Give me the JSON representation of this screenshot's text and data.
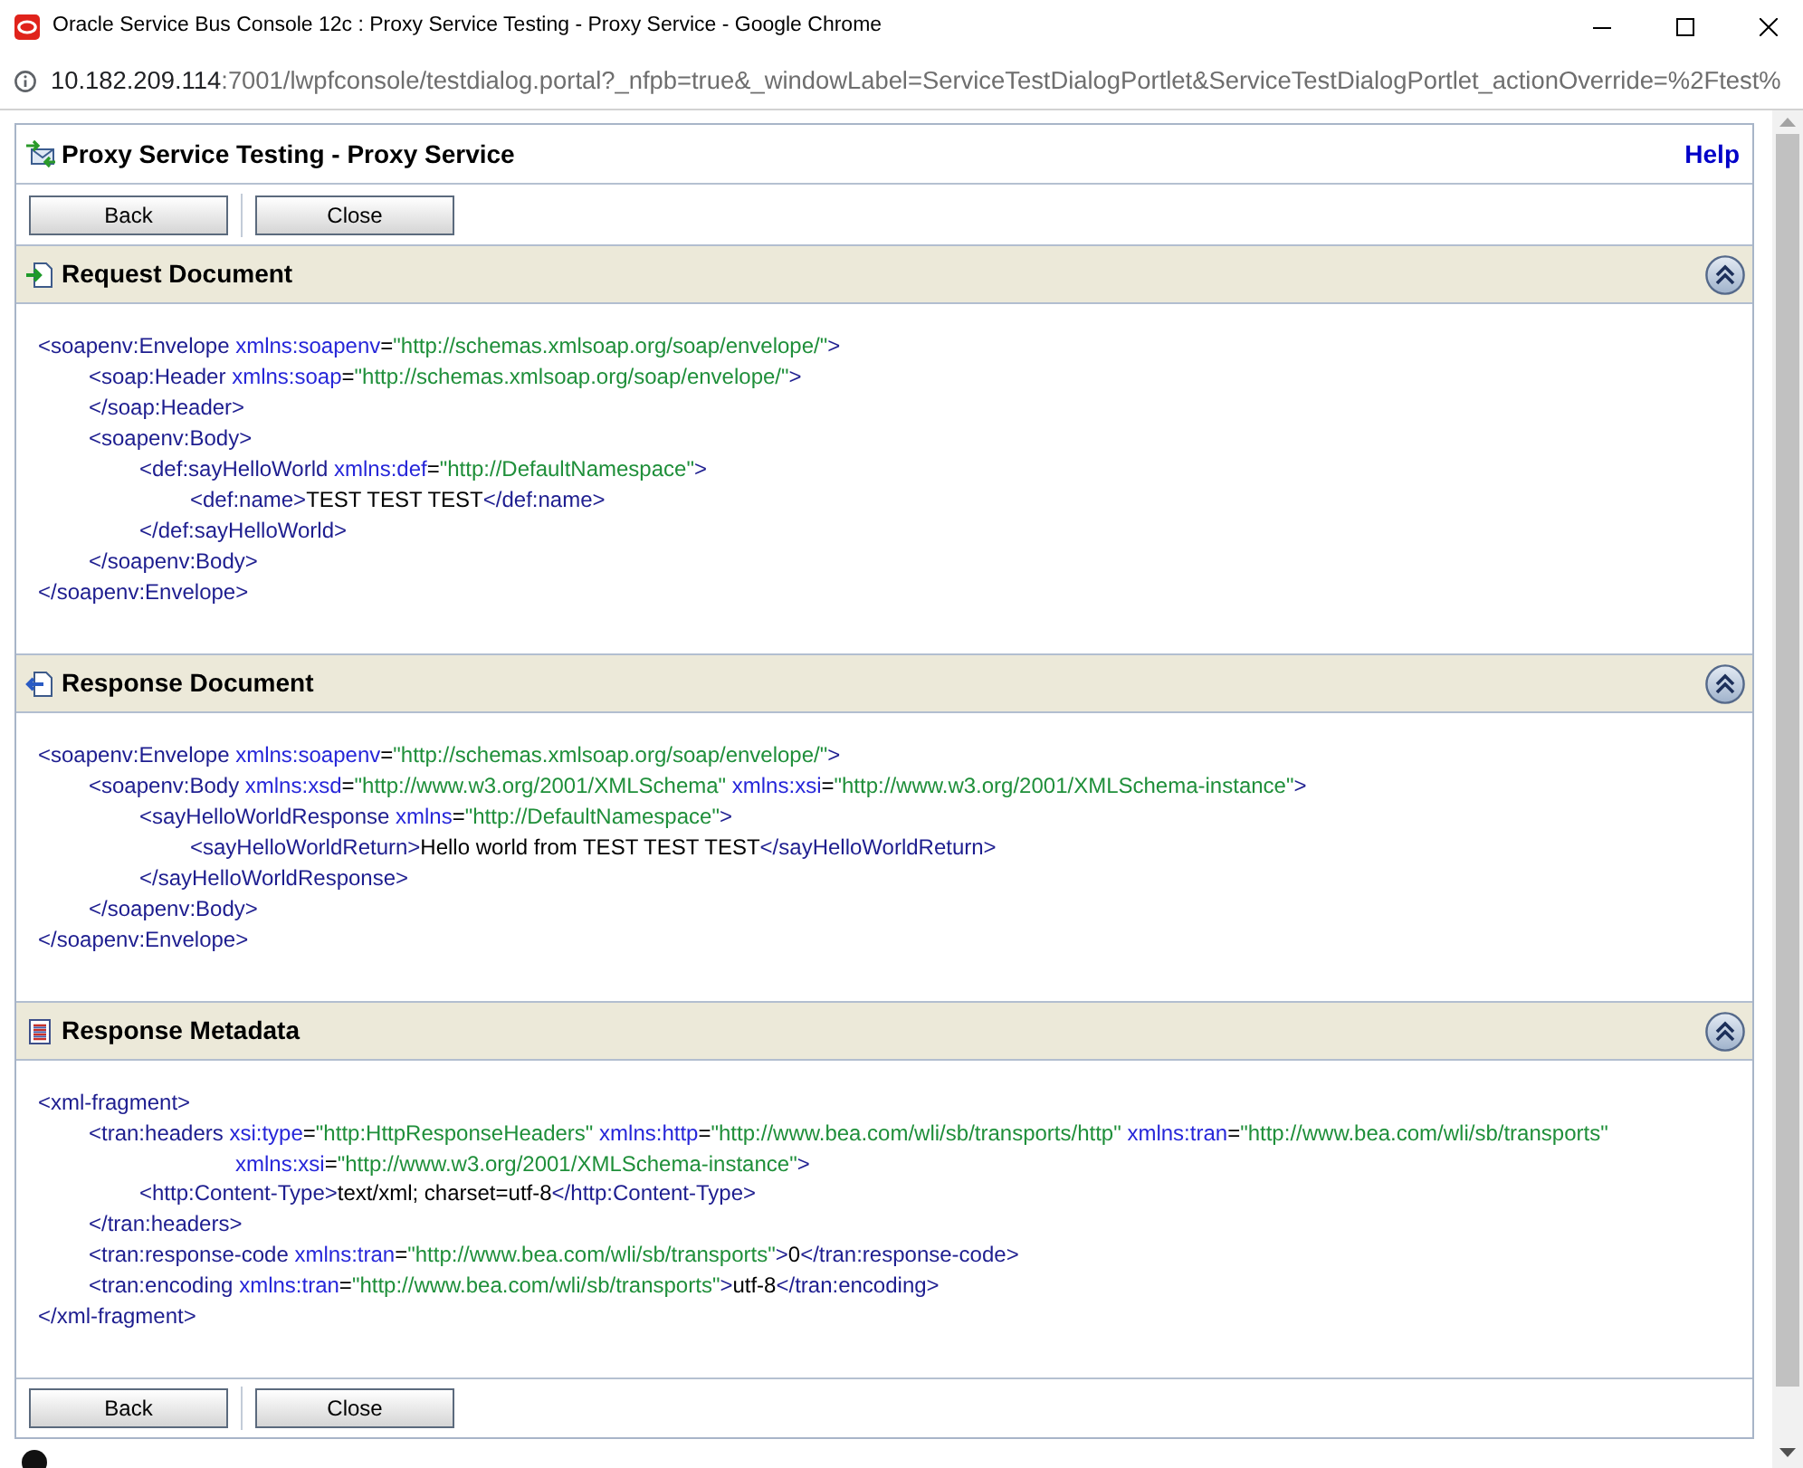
{
  "window": {
    "title": "Oracle Service Bus Console 12c : Proxy Service Testing - Proxy Service - Google Chrome"
  },
  "address_bar": {
    "host": "10.182.209.114",
    "rest": ":7001/lwpfconsole/testdialog.portal?_nfpb=true&_windowLabel=ServiceTestDialogPortlet&ServiceTestDialogPortlet_actionOverride=%2Ftest%"
  },
  "page": {
    "title": "Proxy Service Testing - Proxy Service",
    "help_link": "Help",
    "top_buttons": [
      "Back",
      "Close"
    ],
    "sections": [
      {
        "kind": "request",
        "title": "Request Document",
        "expanded": true,
        "xml": [
          {
            "open": [
              {
                "kind": "tag",
                "text": "<soapenv:Envelope"
              },
              {
                "kind": "attr",
                "text": " xmlns:soapenv"
              },
              {
                "kind": "eq",
                "text": "="
              },
              {
                "kind": "value",
                "text": "\"http://schemas.xmlsoap.org/soap/envelope/\""
              },
              {
                "kind": "tag",
                "text": ">"
              }
            ],
            "children": [
              {
                "open": [
                  {
                    "kind": "tag",
                    "text": "<soap:Header"
                  },
                  {
                    "kind": "attr",
                    "text": " xmlns:soap"
                  },
                  {
                    "kind": "eq",
                    "text": "="
                  },
                  {
                    "kind": "value",
                    "text": "\"http://schemas.xmlsoap.org/soap/envelope/\""
                  },
                  {
                    "kind": "tag",
                    "text": ">"
                  }
                ],
                "close": [
                  {
                    "kind": "tag",
                    "text": "</soap:Header>"
                  }
                ]
              },
              {
                "open": [
                  {
                    "kind": "tag",
                    "text": "<soapenv:Body>"
                  }
                ],
                "children": [
                  {
                    "open": [
                      {
                        "kind": "tag",
                        "text": "<def:sayHelloWorld"
                      },
                      {
                        "kind": "attr",
                        "text": " xmlns:def"
                      },
                      {
                        "kind": "eq",
                        "text": "="
                      },
                      {
                        "kind": "value",
                        "text": "\"http://DefaultNamespace\""
                      },
                      {
                        "kind": "tag",
                        "text": ">"
                      }
                    ],
                    "children": [
                      {
                        "open": [
                          {
                            "kind": "tag",
                            "text": "<def:name>"
                          },
                          {
                            "kind": "text",
                            "text": "TEST TEST TEST"
                          },
                          {
                            "kind": "tag",
                            "text": "</def:name>"
                          }
                        ]
                      }
                    ],
                    "close": [
                      {
                        "kind": "tag",
                        "text": "</def:sayHelloWorld>"
                      }
                    ]
                  }
                ],
                "close": [
                  {
                    "kind": "tag",
                    "text": "</soapenv:Body>"
                  }
                ]
              }
            ],
            "close": [
              {
                "kind": "tag",
                "text": "</soapenv:Envelope>"
              }
            ]
          }
        ]
      },
      {
        "kind": "response",
        "title": "Response Document",
        "expanded": true,
        "xml": [
          {
            "open": [
              {
                "kind": "tag",
                "text": "<soapenv:Envelope"
              },
              {
                "kind": "attr",
                "text": " xmlns:soapenv"
              },
              {
                "kind": "eq",
                "text": "="
              },
              {
                "kind": "value",
                "text": "\"http://schemas.xmlsoap.org/soap/envelope/\""
              },
              {
                "kind": "tag",
                "text": ">"
              }
            ],
            "children": [
              {
                "open": [
                  {
                    "kind": "tag",
                    "text": "<soapenv:Body"
                  },
                  {
                    "kind": "attr",
                    "text": " xmlns:xsd"
                  },
                  {
                    "kind": "eq",
                    "text": "="
                  },
                  {
                    "kind": "value",
                    "text": "\"http://www.w3.org/2001/XMLSchema\""
                  },
                  {
                    "kind": "attr",
                    "text": " xmlns:xsi"
                  },
                  {
                    "kind": "eq",
                    "text": "="
                  },
                  {
                    "kind": "value",
                    "text": "\"http://www.w3.org/2001/XMLSchema-instance\""
                  },
                  {
                    "kind": "tag",
                    "text": ">"
                  }
                ],
                "children": [
                  {
                    "open": [
                      {
                        "kind": "tag",
                        "text": "<sayHelloWorldResponse"
                      },
                      {
                        "kind": "attr",
                        "text": " xmlns"
                      },
                      {
                        "kind": "eq",
                        "text": "="
                      },
                      {
                        "kind": "value",
                        "text": "\"http://DefaultNamespace\""
                      },
                      {
                        "kind": "tag",
                        "text": ">"
                      }
                    ],
                    "children": [
                      {
                        "open": [
                          {
                            "kind": "tag",
                            "text": "<sayHelloWorldReturn>"
                          },
                          {
                            "kind": "text",
                            "text": "Hello world from TEST TEST TEST"
                          },
                          {
                            "kind": "tag",
                            "text": "</sayHelloWorldReturn>"
                          }
                        ]
                      }
                    ],
                    "close": [
                      {
                        "kind": "tag",
                        "text": "</sayHelloWorldResponse>"
                      }
                    ]
                  }
                ],
                "close": [
                  {
                    "kind": "tag",
                    "text": "</soapenv:Body>"
                  }
                ]
              }
            ],
            "close": [
              {
                "kind": "tag",
                "text": "</soapenv:Envelope>"
              }
            ]
          }
        ]
      },
      {
        "kind": "metadata",
        "title": "Response Metadata",
        "expanded": true,
        "xml": [
          {
            "open": [
              {
                "kind": "tag",
                "text": "<xml-fragment>"
              }
            ],
            "children": [
              {
                "open": [
                  {
                    "kind": "tag",
                    "text": "<tran:headers"
                  },
                  {
                    "kind": "attr",
                    "text": " xsi:type"
                  },
                  {
                    "kind": "eq",
                    "text": "="
                  },
                  {
                    "kind": "value",
                    "text": "\"http:HttpResponseHeaders\""
                  },
                  {
                    "kind": "attr",
                    "text": " xmlns:http"
                  },
                  {
                    "kind": "eq",
                    "text": "="
                  },
                  {
                    "kind": "value",
                    "text": "\"http://www.bea.com/wli/sb/transports/http\""
                  },
                  {
                    "kind": "attr",
                    "text": " xmlns:tran"
                  },
                  {
                    "kind": "eq",
                    "text": "="
                  },
                  {
                    "kind": "value",
                    "text": "\"http://www.bea.com/wli/sb/transports\""
                  }
                ],
                "wrap": [
                  {
                    "kind": "attr",
                    "text": "xmlns:xsi"
                  },
                  {
                    "kind": "eq",
                    "text": "="
                  },
                  {
                    "kind": "value",
                    "text": "\"http://www.w3.org/2001/XMLSchema-instance\""
                  },
                  {
                    "kind": "tag",
                    "text": ">"
                  }
                ],
                "children": [
                  {
                    "open": [
                      {
                        "kind": "tag",
                        "text": "<http:Content-Type>"
                      },
                      {
                        "kind": "text",
                        "text": "text/xml; charset=utf-8"
                      },
                      {
                        "kind": "tag",
                        "text": "</http:Content-Type>"
                      }
                    ]
                  }
                ],
                "close": [
                  {
                    "kind": "tag",
                    "text": "</tran:headers>"
                  }
                ]
              },
              {
                "open": [
                  {
                    "kind": "tag",
                    "text": "<tran:response-code"
                  },
                  {
                    "kind": "attr",
                    "text": " xmlns:tran"
                  },
                  {
                    "kind": "eq",
                    "text": "="
                  },
                  {
                    "kind": "value",
                    "text": "\"http://www.bea.com/wli/sb/transports\""
                  },
                  {
                    "kind": "tag",
                    "text": ">"
                  },
                  {
                    "kind": "text",
                    "text": "0"
                  },
                  {
                    "kind": "tag",
                    "text": "</tran:response-code>"
                  }
                ]
              },
              {
                "open": [
                  {
                    "kind": "tag",
                    "text": "<tran:encoding"
                  },
                  {
                    "kind": "attr",
                    "text": " xmlns:tran"
                  },
                  {
                    "kind": "eq",
                    "text": "="
                  },
                  {
                    "kind": "value",
                    "text": "\"http://www.bea.com/wli/sb/transports\""
                  },
                  {
                    "kind": "tag",
                    "text": ">"
                  },
                  {
                    "kind": "text",
                    "text": "utf-8"
                  },
                  {
                    "kind": "tag",
                    "text": "</tran:encoding>"
                  }
                ]
              }
            ],
            "close": [
              {
                "kind": "tag",
                "text": "</xml-fragment>"
              }
            ]
          }
        ]
      }
    ],
    "bottom_buttons": [
      "Back",
      "Close"
    ]
  }
}
